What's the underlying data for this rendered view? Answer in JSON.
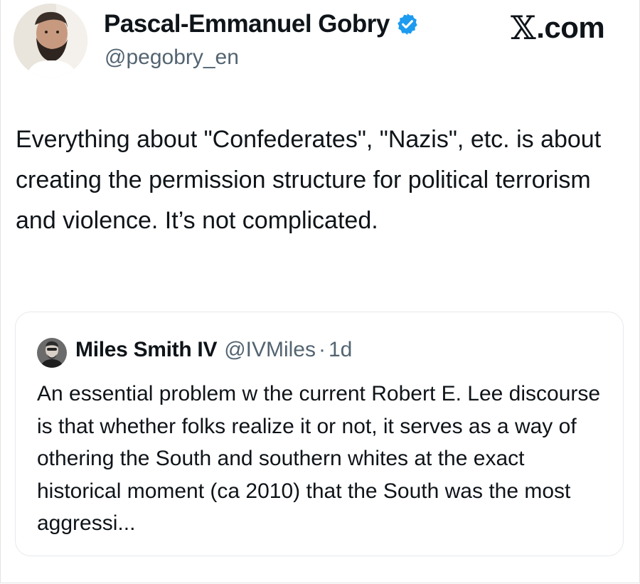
{
  "brand": {
    "logo_glyph": "𝕏",
    "domain": ".com"
  },
  "tweet": {
    "author_name": "Pascal-Emmanuel Gobry",
    "author_handle": "@pegobry_en",
    "verified_icon": "verified-badge-icon",
    "text": "Everything about \"Confederates\", \"Nazis\", etc. is about creating the permission structure for political terrorism and violence. It’s not complicated."
  },
  "quote": {
    "author_name": "Miles Smith IV",
    "author_handle": "@IVMiles",
    "separator": "·",
    "time": "1d",
    "text": "An essential problem w the current Robert E. Lee discourse is that whether folks realize it or not, it serves as a way of othering the South and southern whites at the exact historical moment (ca 2010) that the South was the most aggressi..."
  },
  "colors": {
    "text": "#0f1419",
    "secondary": "#536471",
    "verified": "#1d9bf0",
    "card_border": "#e6e9ec"
  }
}
